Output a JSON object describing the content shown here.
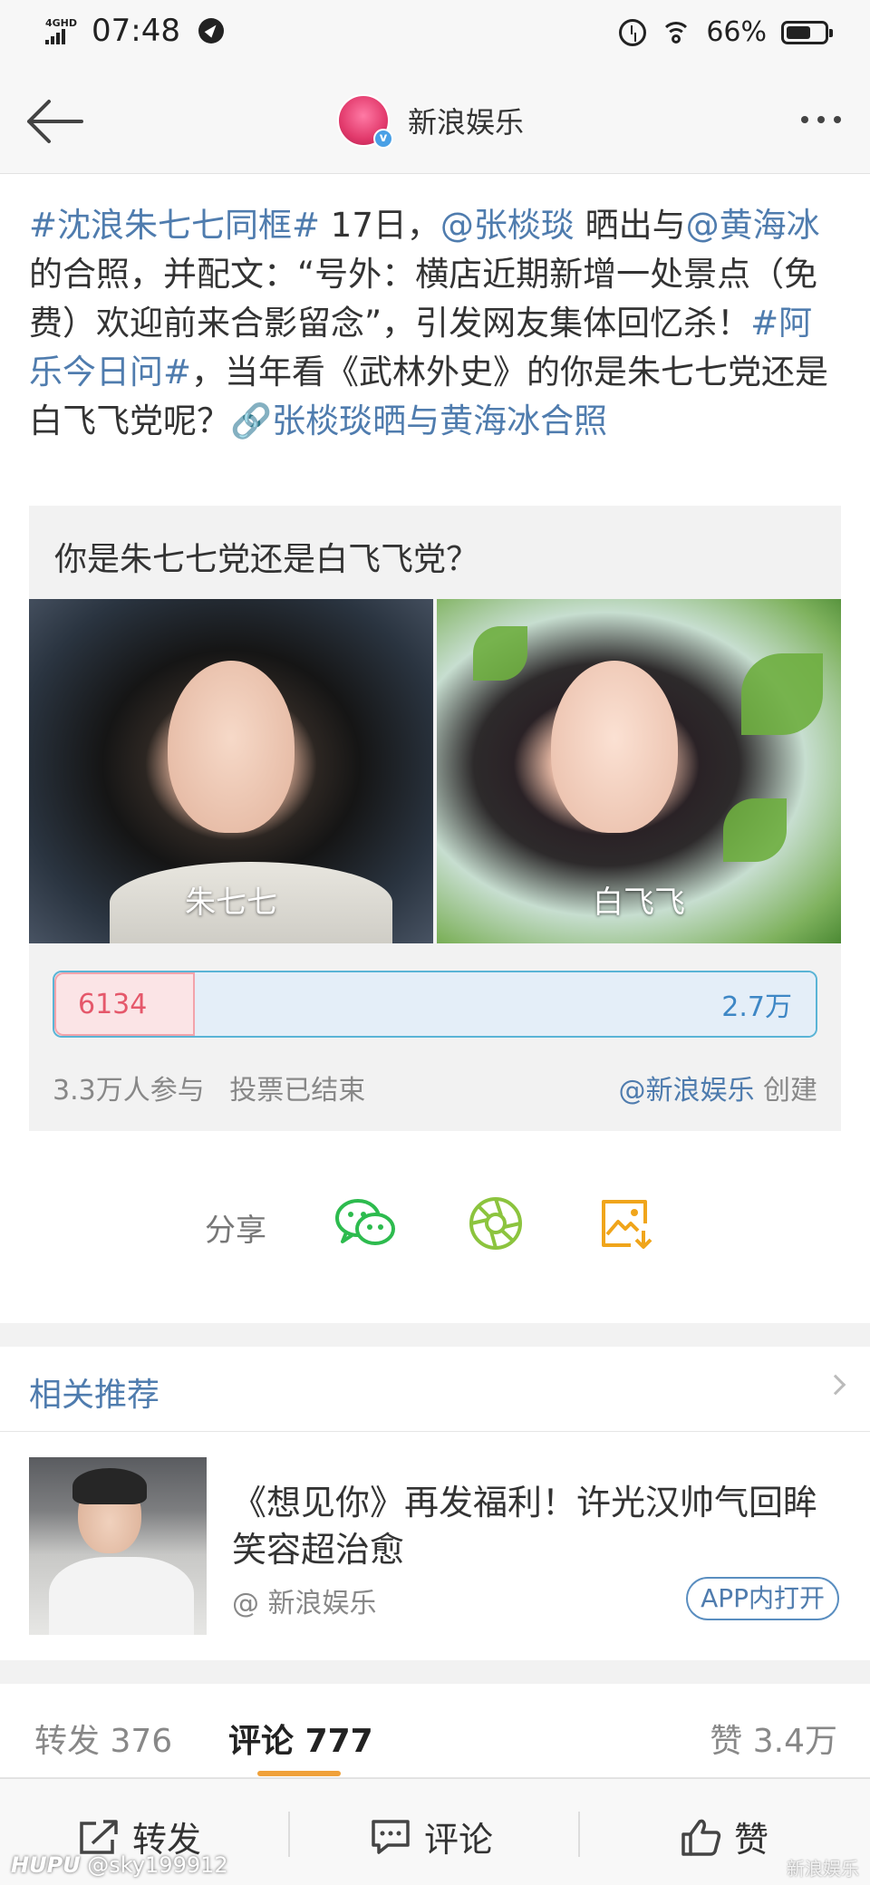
{
  "status_bar": {
    "network": "4GHD",
    "time": "07:48",
    "battery": "66%",
    "battery_level": 0.66
  },
  "nav": {
    "title": "新浪娱乐"
  },
  "post": {
    "segments": [
      {
        "text": "#沈浪朱七七同框#",
        "link": true
      },
      {
        "text": " 17日，",
        "link": false
      },
      {
        "text": "@张棪琰",
        "link": true
      },
      {
        "text": " 晒出与",
        "link": false
      },
      {
        "text": "@黄海冰",
        "link": true
      },
      {
        "text": " 的合照，并配文：“号外：横店近期新增一处景点（免费）欢迎前来合影留念”，引发网友集体回忆杀！",
        "link": false
      },
      {
        "text": "#阿乐今日问#",
        "link": true
      },
      {
        "text": "，当年看《武林外史》的你是朱七七党还是白飞飞党呢？",
        "link": false
      },
      {
        "text": "🔗张棪琰晒与黄海冰合照",
        "link": true
      }
    ]
  },
  "poll": {
    "question": "你是朱七七党还是白飞飞党？",
    "options": [
      {
        "label": "朱七七",
        "votes": "6134"
      },
      {
        "label": "白飞飞",
        "votes": "2.7万"
      }
    ],
    "split": 0.185,
    "participants": "3.3万人参与",
    "status": "投票已结束",
    "creator": "@新浪娱乐",
    "creator_suffix": " 创建"
  },
  "share": {
    "label": "分享",
    "icons": [
      "wechat-icon",
      "moments-icon",
      "save-image-icon"
    ]
  },
  "related": {
    "title": "相关推荐",
    "item": {
      "title": "《想见你》再发福利！许光汉帅气回眸笑容超治愈",
      "source": "@ 新浪娱乐",
      "open_label": "APP内打开"
    }
  },
  "stats": {
    "reposts_label": "转发",
    "reposts": "376",
    "comments_label": "评论",
    "comments": "777",
    "likes_label": "赞",
    "likes": "3.4万"
  },
  "actions": {
    "repost": "转发",
    "comment": "评论",
    "like": "赞"
  },
  "watermark": {
    "site": "HUPU",
    "user": " @sky199912",
    "right": "新浪娱乐"
  },
  "colors": {
    "link": "#4f7cae",
    "vote_a": "#e5586b",
    "vote_b": "#3e87c5",
    "tab_accent": "#f0a13a"
  }
}
